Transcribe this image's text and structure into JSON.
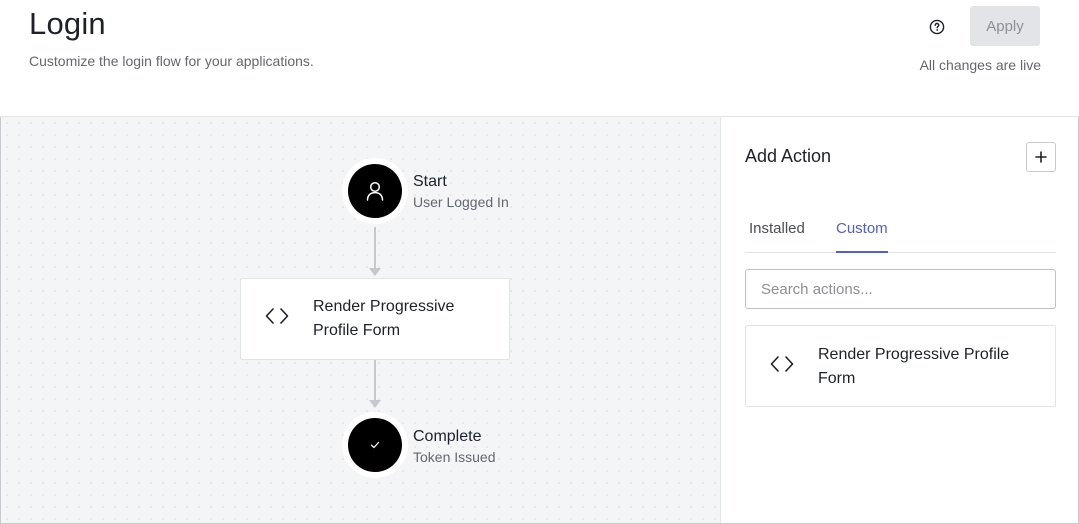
{
  "header": {
    "title": "Login",
    "subtitle": "Customize the login flow for your applications.",
    "apply_label": "Apply",
    "status": "All changes are live",
    "help_icon": "help-circle-icon"
  },
  "flow": {
    "start": {
      "title": "Start",
      "subtitle": "User Logged In",
      "icon": "user-icon"
    },
    "action": {
      "title": "Render Progressive Profile Form",
      "icon": "code-icon"
    },
    "complete": {
      "title": "Complete",
      "subtitle": "Token Issued",
      "icon": "check-icon"
    }
  },
  "panel": {
    "title": "Add Action",
    "add_icon": "plus-icon",
    "tabs": [
      {
        "label": "Installed",
        "active": false
      },
      {
        "label": "Custom",
        "active": true
      }
    ],
    "search": {
      "placeholder": "Search actions...",
      "value": ""
    },
    "actions": [
      {
        "label": "Render Progressive Profile Form",
        "icon": "code-icon"
      }
    ]
  },
  "colors": {
    "accent": "#4f5ed9",
    "node": "#000000",
    "canvas_bg": "#f4f5f7",
    "apply_bg": "#e3e4e8"
  }
}
